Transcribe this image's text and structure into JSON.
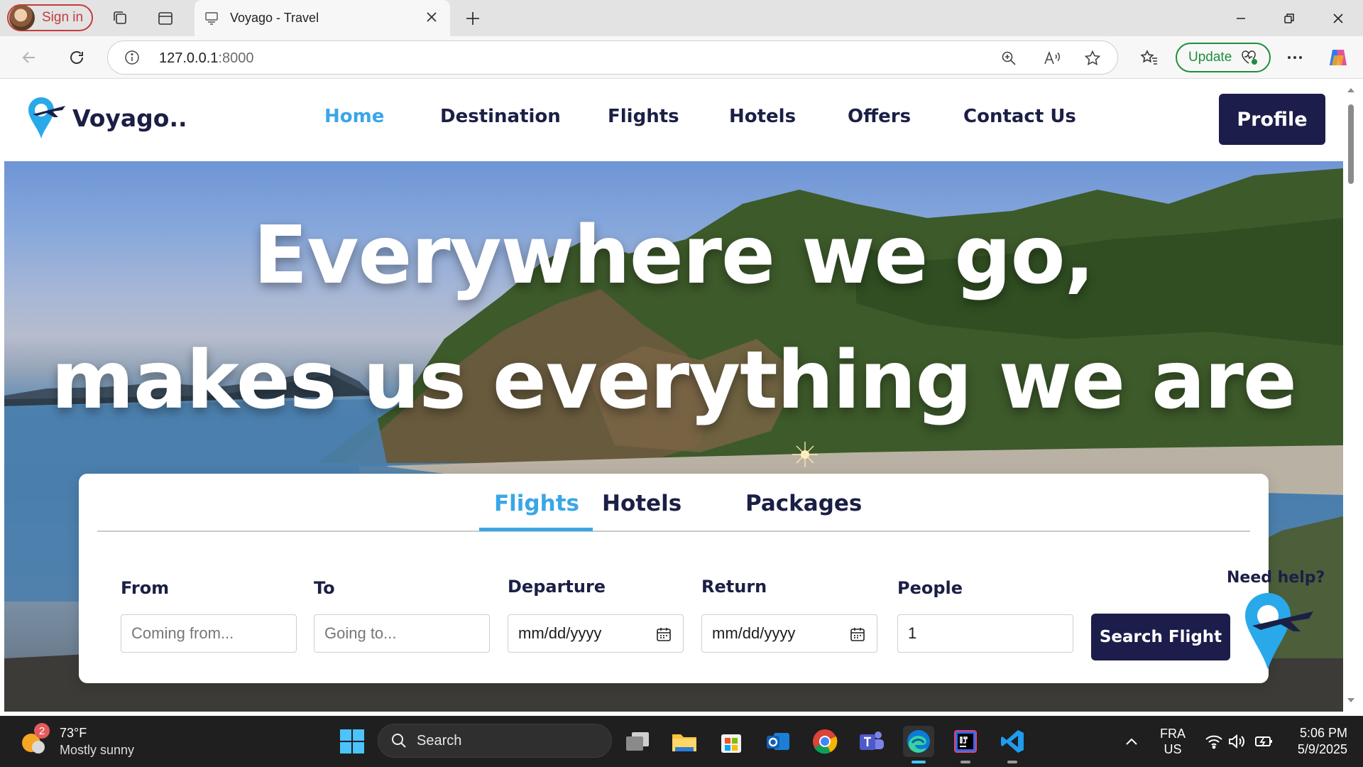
{
  "browser": {
    "signin_label": "Sign in",
    "tab_title": "Voyago - Travel",
    "url_host": "127.0.0.1",
    "url_port": ":8000",
    "update_label": "Update"
  },
  "site": {
    "logo_text": "Voyago..",
    "nav": [
      "Home",
      "Destination",
      "Flights",
      "Hotels",
      "Offers",
      "Contact Us"
    ],
    "profile_label": "Profile",
    "hero_line1": "Everywhere we go,",
    "hero_line2": "makes us everything we are",
    "search_tabs": [
      "Flights",
      "Hotels",
      "Packages"
    ],
    "fields": {
      "from_label": "From",
      "from_placeholder": "Coming from...",
      "to_label": "To",
      "to_placeholder": "Going to...",
      "departure_label": "Departure",
      "departure_value": "mm/dd/yyyy",
      "return_label": "Return",
      "return_value": "mm/dd/yyyy",
      "people_label": "People",
      "people_value": "1"
    },
    "search_button": "Search Flight",
    "help_text": "Need help?"
  },
  "taskbar": {
    "weather_temp": "73°F",
    "weather_desc": "Mostly sunny",
    "weather_badge": "2",
    "search_label": "Search",
    "lang_1": "FRA",
    "lang_2": "US",
    "time": "5:06 PM",
    "date": "5/9/2025"
  },
  "colors": {
    "accent": "#3aa6e8",
    "navy": "#1c1d4a",
    "update_green": "#1e8e3e",
    "signin_red": "#c53b3b"
  }
}
